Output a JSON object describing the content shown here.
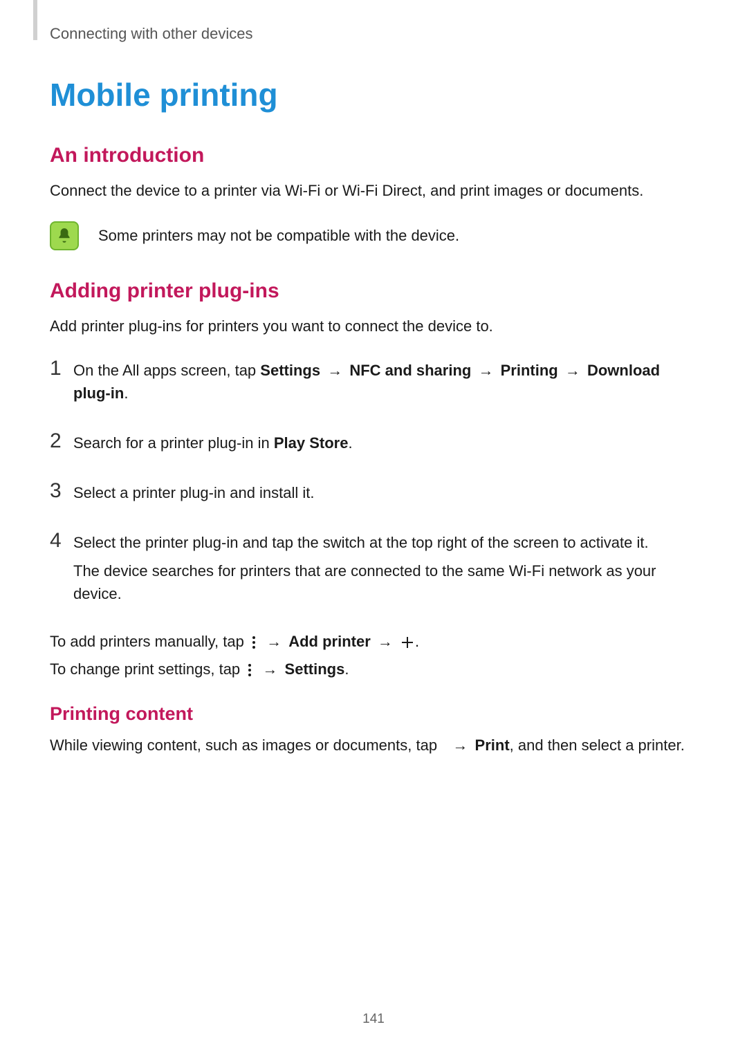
{
  "breadcrumb": "Connecting with other devices",
  "title": "Mobile printing",
  "intro": {
    "heading": "An introduction",
    "body": "Connect the device to a printer via Wi-Fi or Wi-Fi Direct, and print images or documents.",
    "note": "Some printers may not be compatible with the device."
  },
  "plugins": {
    "heading": "Adding printer plug-ins",
    "intro": "Add printer plug-ins for printers you want to connect the device to.",
    "steps": {
      "s1_a": "On the All apps screen, tap ",
      "s1_b": "Settings",
      "s1_c": "NFC and sharing",
      "s1_d": "Printing",
      "s1_e": "Download plug-in",
      "s2_a": "Search for a printer plug-in in ",
      "s2_b": "Play Store",
      "s3": "Select a printer plug-in and install it.",
      "s4_a": "Select the printer plug-in and tap the switch at the top right of the screen to activate it.",
      "s4_b": "The device searches for printers that are connected to the same Wi-Fi network as your device."
    },
    "manual_a": "To add printers manually, tap ",
    "manual_b": "Add printer",
    "settings_a": "To change print settings, tap ",
    "settings_b": "Settings"
  },
  "printing": {
    "heading": "Printing content",
    "body_a": "While viewing content, such as images or documents, tap ",
    "body_b": "Print",
    "body_c": ", and then select a printer."
  },
  "arrow": "→",
  "period": ".",
  "page_number": "141"
}
